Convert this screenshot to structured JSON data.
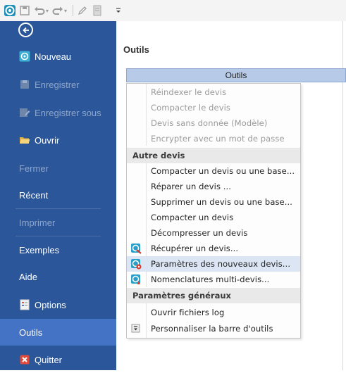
{
  "toolbar": {
    "icons": [
      "app-icon",
      "save-icon",
      "undo-icon",
      "redo-icon",
      "edit-icon",
      "document-icon",
      "customize-icon"
    ]
  },
  "sidebar": {
    "back_icon": "arrow-left-circle-icon",
    "items": [
      {
        "label": "Nouveau",
        "enabled": true
      },
      {
        "label": "Enregistrer",
        "enabled": false
      },
      {
        "label": "Enregistrer sous",
        "enabled": false
      },
      {
        "label": "Ouvrir",
        "enabled": true
      },
      {
        "label": "Fermer",
        "enabled": false
      },
      {
        "label": "Récent",
        "enabled": true
      },
      {
        "label": "Imprimer",
        "enabled": false
      },
      {
        "label": "Exemples",
        "enabled": true
      },
      {
        "label": "Aide",
        "enabled": true
      },
      {
        "label": "Options",
        "enabled": true
      },
      {
        "label": "Outils",
        "enabled": true,
        "selected": true
      },
      {
        "label": "Quitter",
        "enabled": true
      }
    ]
  },
  "main": {
    "title": "Outils",
    "dropdown_label": "Outils"
  },
  "menu": {
    "items": [
      {
        "label": "Réindexer le devis",
        "enabled": false
      },
      {
        "label": "Compacter le devis",
        "enabled": false
      },
      {
        "label": "Devis sans donnée (Modèle)",
        "enabled": false
      },
      {
        "label": "Encrypter avec un mot de passe",
        "enabled": false
      }
    ],
    "header_other": "Autre devis",
    "other_items": [
      {
        "label": "Compacter un devis ou une base..."
      },
      {
        "label": "Réparer un devis ..."
      },
      {
        "label": "Supprimer un devis ou une base..."
      },
      {
        "label": "Compacter un devis"
      },
      {
        "label": "Décompresser un devis"
      },
      {
        "label": "Récupérer un devis..."
      },
      {
        "label": "Paramètres des nouveaux devis...",
        "highlighted": true
      },
      {
        "label": "Nomenclatures multi-devis..."
      }
    ],
    "header_general": "Paramètres généraux",
    "general_items": [
      {
        "label": "Ouvrir fichiers log"
      },
      {
        "label": "Personnaliser la barre d'outils"
      }
    ]
  },
  "colors": {
    "sidebar_bg": "#2b579a",
    "sidebar_selected": "#4472c4",
    "dropdown_bg": "#b7cbe8",
    "menu_highlight": "#dbe5f3"
  }
}
